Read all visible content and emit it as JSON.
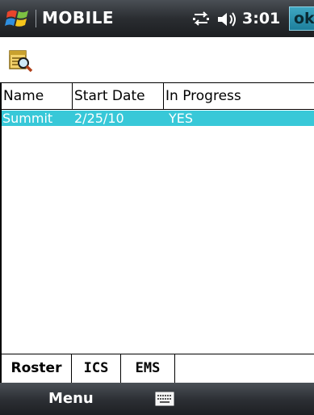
{
  "titlebar": {
    "title": "MOBILE",
    "time": "3:01",
    "ok_label": "ok"
  },
  "toolbar": {
    "icon": "report-search-icon"
  },
  "table": {
    "columns": [
      "Name",
      "Start Date",
      "In Progress"
    ],
    "rows": [
      [
        "Summit",
        "2/25/10",
        "YES"
      ]
    ]
  },
  "tabs": [
    "Roster",
    "ICS",
    "EMS"
  ],
  "menubar": {
    "menu_label": "Menu"
  },
  "colors": {
    "selection": "#38c8d8",
    "bar": "#2a2d31"
  }
}
